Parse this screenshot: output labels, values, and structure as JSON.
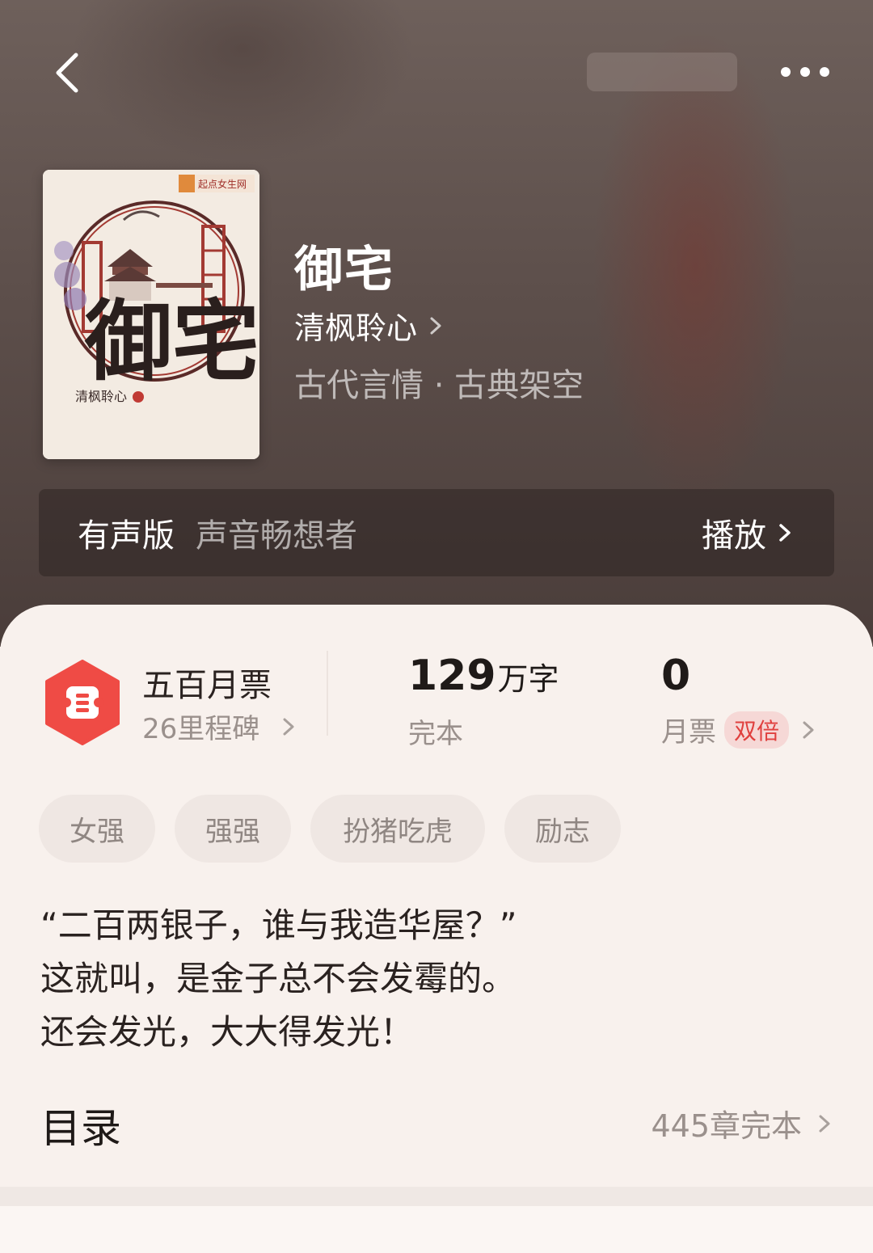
{
  "book": {
    "title": "御宅",
    "author": "清枫聆心",
    "genre": "古代言情 · 古典架空",
    "cover": {
      "brand": "起点女生网",
      "title": "御宅",
      "author": "清枫聆心"
    }
  },
  "audio": {
    "label": "有声版",
    "narrator": "声音畅想者",
    "play_label": "播放"
  },
  "stats": {
    "ticket_title": "五百月票",
    "ticket_sub": "26里程碑",
    "words_num": "129",
    "words_unit": "万字",
    "status": "完本",
    "votes_num": "0",
    "votes_label": "月票",
    "double_label": "双倍"
  },
  "tags": [
    "女强",
    "强强",
    "扮猪吃虎",
    "励志"
  ],
  "description": [
    "“二百两银子，谁与我造华屋？”",
    "这就叫，是金子总不会发霉的。",
    "还会发光，大大得发光！"
  ],
  "toc": {
    "title": "目录",
    "info": "445章完本"
  },
  "colors": {
    "accent_red": "#e0403e",
    "badge_red": "#ef4b45"
  }
}
